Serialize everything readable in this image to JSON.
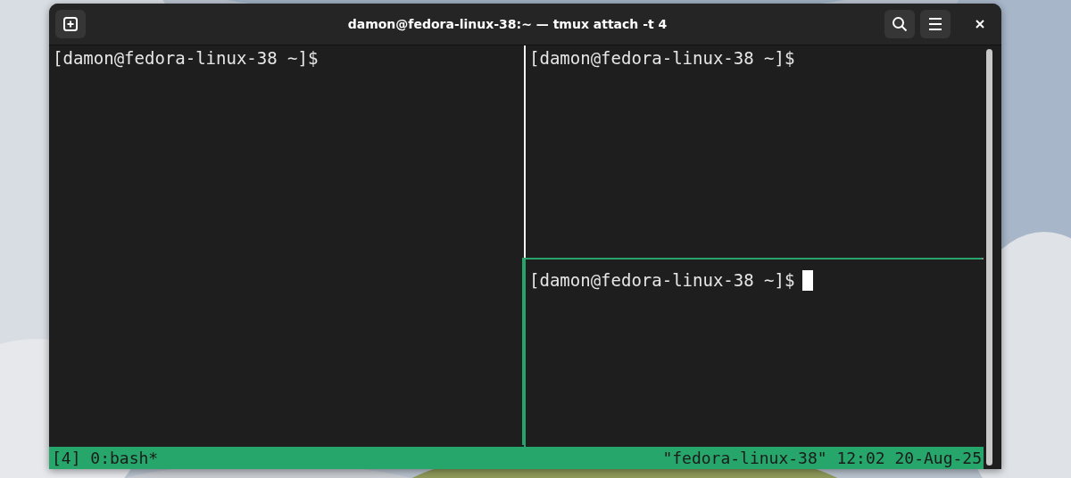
{
  "window": {
    "title": "damon@fedora-linux-38:~ — tmux attach -t 4"
  },
  "panes": [
    {
      "prompt": "[damon@fedora-linux-38 ~]$",
      "active": false
    },
    {
      "prompt": "[damon@fedora-linux-38 ~]$",
      "active": false
    },
    {
      "prompt": "[damon@fedora-linux-38 ~]$",
      "active": true
    }
  ],
  "status_bar": {
    "left": "[4] 0:bash*",
    "right": "\"fedora-linux-38\" 12:02 20-Aug-25"
  }
}
